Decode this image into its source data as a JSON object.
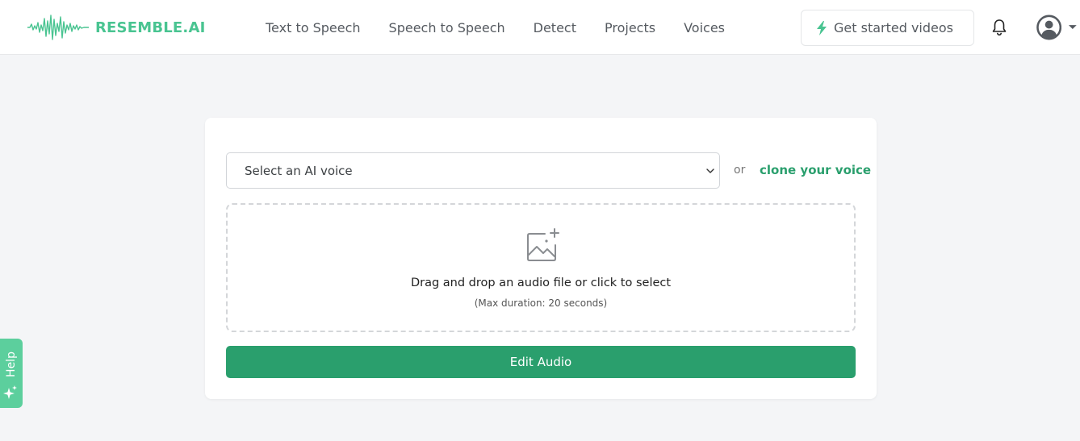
{
  "brand": {
    "name": "RESEMBLE.AI",
    "color": "#49c491"
  },
  "nav": {
    "items": [
      {
        "label": "Text to Speech"
      },
      {
        "label": "Speech to Speech"
      },
      {
        "label": "Detect"
      },
      {
        "label": "Projects"
      },
      {
        "label": "Voices"
      }
    ]
  },
  "header_actions": {
    "get_started_label": "Get started videos",
    "get_started_icon": "lightning-icon",
    "notifications_icon": "bell-icon",
    "account_icon": "user-avatar-icon",
    "account_menu_icon": "caret-down-icon"
  },
  "form": {
    "voice_select": {
      "selected": "Select an AI voice"
    },
    "or_text": "or",
    "clone_link": "clone your voice",
    "dropzone": {
      "icon": "image-add-icon",
      "title": "Drag and drop an audio file or click to select",
      "subtitle": "(Max duration: 20 seconds)"
    },
    "submit_label": "Edit Audio"
  },
  "help": {
    "label": "Help",
    "icon": "sparkle-icon"
  },
  "colors": {
    "accent": "#2a9f6d",
    "help_tab": "#5ccf9d",
    "background": "#f4f5f7"
  }
}
